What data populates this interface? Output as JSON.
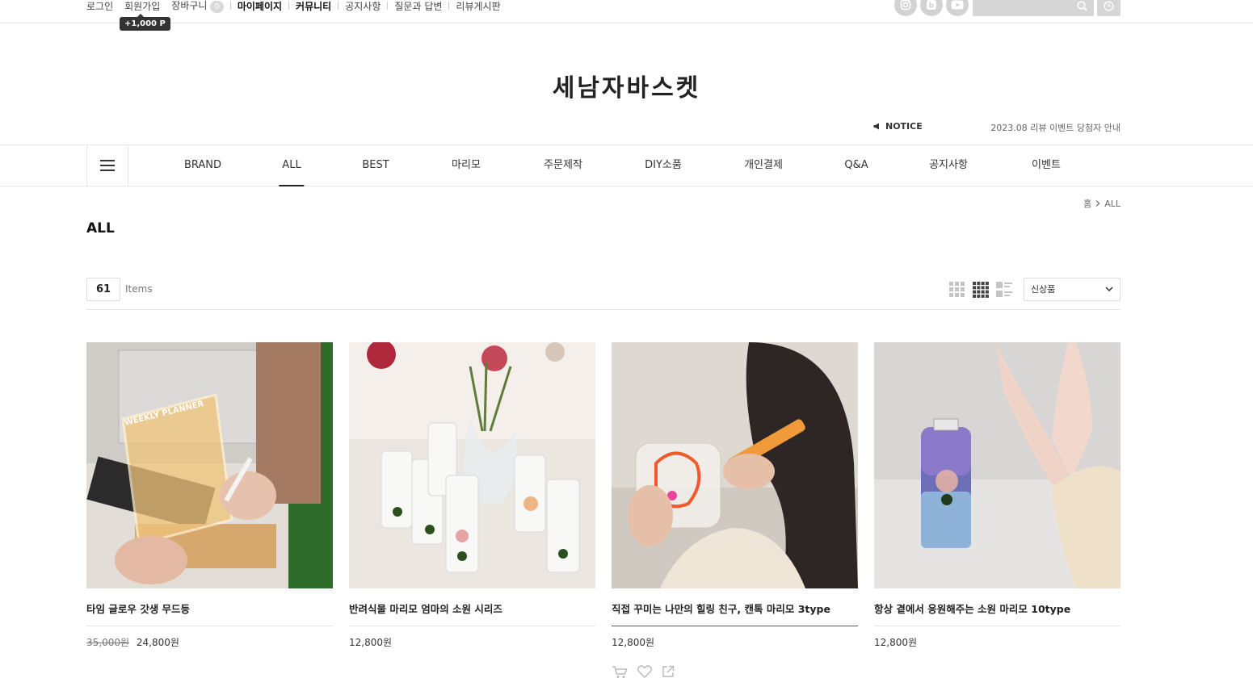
{
  "top_links": {
    "login": "로그인",
    "join": "회원가입",
    "cart": "장바구니",
    "cart_count": "0",
    "mypage": "마이페이지",
    "community": "커뮤니티",
    "notice": "공지사항",
    "qna": "질문과 답변",
    "review": "리뷰게시판",
    "join_point": "+1,000 P"
  },
  "social_icons": [
    "instagram-icon",
    "blog-icon",
    "youtube-icon"
  ],
  "search": {
    "placeholder": ""
  },
  "brand": {
    "logo": "세남자바스켓"
  },
  "notice_bar": {
    "label": "NOTICE",
    "text": "2023.08 리뷰 이벤트 당첨자 안내"
  },
  "nav": {
    "items": [
      "BRAND",
      "ALL",
      "BEST",
      "마리모",
      "주문제작",
      "DIY소품",
      "개인결제",
      "Q&A",
      "공지사항",
      "이벤트"
    ],
    "active": "ALL"
  },
  "breadcrumb": {
    "home": "홈",
    "current": "ALL"
  },
  "page": {
    "title": "ALL"
  },
  "list": {
    "count": "61",
    "count_label": "Items",
    "sort_selected": "신상품"
  },
  "products": [
    {
      "name": "타임 글로우 갓생 무드등",
      "price_old": "35,000원",
      "price": "24,800원"
    },
    {
      "name": "반려식물 마리모 엄마의 소원 시리즈",
      "price_old": "",
      "price": "12,800원"
    },
    {
      "name": "직접 꾸미는 나만의 힐링 친구, 캔톡 마리모 3type",
      "price_old": "",
      "price": "12,800원"
    },
    {
      "name": "항상 곁에서 응원해주는 소원 마리모 10type",
      "price_old": "",
      "price": "12,800원"
    }
  ],
  "colors": {
    "accent": "#222222",
    "border": "#e5e5e5",
    "icon_bg": "#d2d2d2"
  }
}
